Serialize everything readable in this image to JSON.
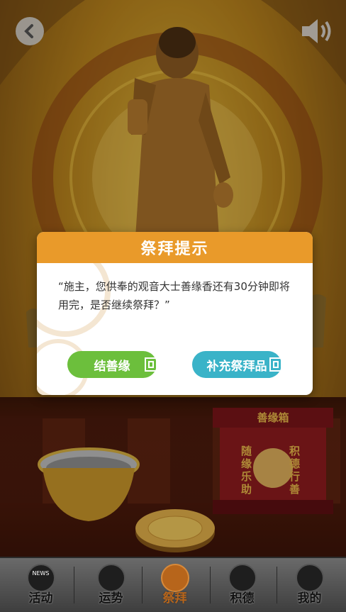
{
  "dialog": {
    "title": "祭拜提示",
    "message": "“施主，您供奉的观音大士善缘香还有30分钟即将用完，是否继续祭拜？”",
    "btn_karma": "结善缘",
    "btn_refill": "补充祭拜品"
  },
  "donation_box": {
    "title": "善缘箱",
    "left_text": "随缘乐助",
    "right_text": "积德行善"
  },
  "tabs": [
    {
      "label": "活动",
      "icon": "news-icon",
      "active": false
    },
    {
      "label": "运势",
      "icon": "fortune-icon",
      "active": false
    },
    {
      "label": "祭拜",
      "icon": "pray-hands-icon",
      "active": true
    },
    {
      "label": "积德",
      "icon": "heart-hand-icon",
      "active": false
    },
    {
      "label": "我的",
      "icon": "user-icon",
      "active": false
    }
  ],
  "icons": {
    "back": "back-arrow-icon",
    "sound": "speaker-icon",
    "tab0_badge": "NEWS"
  },
  "colors": {
    "dialog_header": "#e99a2a",
    "btn_karma": "#6cbf3c",
    "btn_refill": "#3ab3c8",
    "tab_active": "#b7651b"
  }
}
